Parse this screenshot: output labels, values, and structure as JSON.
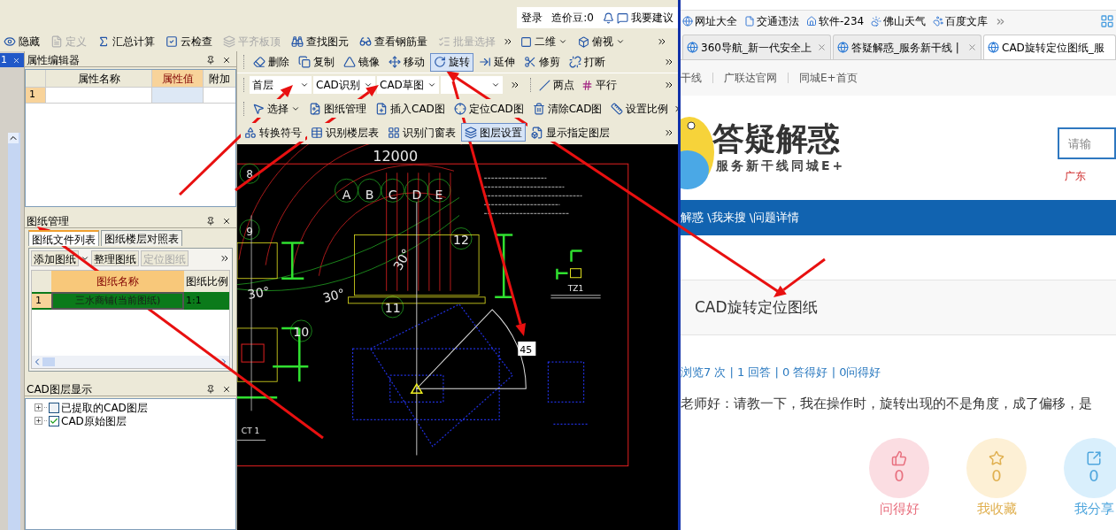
{
  "app": {
    "account_bar": {
      "login": "登录",
      "beans": "造价豆:0",
      "suggest": "我要建议"
    },
    "side_strip": {
      "tab": "1"
    },
    "main_toolbar": [
      {
        "label": "隐藏",
        "disabled": false
      },
      {
        "label": "定义",
        "disabled": true
      },
      {
        "label": "汇总计算",
        "disabled": false
      },
      {
        "label": "云检查",
        "disabled": false
      },
      {
        "label": "平齐板顶",
        "disabled": true
      },
      {
        "label": "查找图元",
        "disabled": false
      },
      {
        "label": "查看钢筋量",
        "disabled": false
      },
      {
        "label": "批量选择",
        "disabled": true
      }
    ],
    "view_selects": [
      "二维",
      "俯视"
    ],
    "edit_toolbar": [
      {
        "label": "删除",
        "selected": false
      },
      {
        "label": "复制",
        "selected": false
      },
      {
        "label": "镜像",
        "selected": false
      },
      {
        "label": "移动",
        "selected": false
      },
      {
        "label": "旋转",
        "selected": true
      },
      {
        "label": "延伸",
        "selected": false
      },
      {
        "label": "修剪",
        "selected": false
      },
      {
        "label": "打断",
        "selected": false
      }
    ],
    "selectors": [
      "首层",
      "CAD识别",
      "CAD草图"
    ],
    "draw_tools": [
      "两点",
      "平行"
    ],
    "cad_toolbar": [
      {
        "label": "选择",
        "kind": "dropdown"
      },
      {
        "label": "图纸管理",
        "kind": "button"
      },
      {
        "label": "插入CAD图",
        "kind": "button"
      },
      {
        "label": "定位CAD图",
        "kind": "button"
      },
      {
        "label": "清除CAD图",
        "kind": "button"
      },
      {
        "label": "设置比例",
        "kind": "button"
      }
    ],
    "recognize_toolbar": [
      {
        "label": "转换符号",
        "selected": false
      },
      {
        "label": "识别楼层表",
        "selected": false
      },
      {
        "label": "识别门窗表",
        "selected": false
      },
      {
        "label": "图层设置",
        "selected": true
      },
      {
        "label": "显示指定图层",
        "selected": false
      }
    ],
    "property_editor": {
      "title": "属性编辑器",
      "columns": [
        "属性名称",
        "属性值",
        "附加"
      ],
      "rows": [
        {
          "index": "1"
        }
      ]
    },
    "drawing_manager": {
      "title": "图纸管理",
      "tabs": [
        {
          "label": "图纸文件列表",
          "selected": true
        },
        {
          "label": "图纸楼层对照表",
          "selected": false
        }
      ],
      "toolbar": [
        {
          "label": "添加图纸",
          "disabled": false
        },
        {
          "label": "整理图纸",
          "disabled": false
        },
        {
          "label": "定位图纸",
          "disabled": true
        }
      ],
      "columns": [
        "图纸名称",
        "图纸比例"
      ],
      "rows": [
        {
          "index": "1",
          "name": "三水商铺(当前图纸)",
          "scale": "1:1",
          "selected": true
        }
      ]
    },
    "cad_layers": {
      "title": "CAD图层显示",
      "items": [
        {
          "label": "已提取的CAD图层",
          "checked": false
        },
        {
          "label": "CAD原始图层",
          "checked": true
        }
      ]
    },
    "canvas": {
      "labels": [
        "12000",
        "A",
        "B",
        "C",
        "D",
        "E",
        "8",
        "9",
        "12",
        "10",
        "11",
        "30°",
        "30°",
        "30°",
        "CT 1",
        "TZ1"
      ],
      "angle_input": "45"
    }
  },
  "browser": {
    "bookmarks": [
      "网址大全",
      "交通违法",
      "软件-234",
      "佛山天气",
      "百度文库"
    ],
    "tabs": [
      {
        "title": "360导航_新一代安全上",
        "selected": false
      },
      {
        "title": "答疑解惑_服务新干线 |",
        "selected": false
      },
      {
        "title": "CAD旋转定位图纸_服",
        "selected": true
      }
    ],
    "site_links": [
      "干线",
      "广联达官网",
      "同城E+首页"
    ],
    "logo": {
      "title": "答疑解惑",
      "subtitle": "服务新干线同城E+"
    },
    "search": {
      "placeholder": "请输"
    },
    "region": "广东",
    "breadcrumb": "解惑 \\我来搜 \\问题详情",
    "question": {
      "title": "CAD旋转定位图纸",
      "stats": "浏览7 次 | 1 回答 | 0 答得好 | 0问得好",
      "body": "老师好：请教一下，我在操作时，旋转出现的不是角度，成了偏移，是"
    },
    "actions": [
      {
        "kind": "like",
        "count": "0",
        "label": "问得好"
      },
      {
        "kind": "favorite",
        "count": "0",
        "label": "我收藏"
      },
      {
        "kind": "share",
        "count": "0",
        "label": "我分享"
      }
    ]
  }
}
